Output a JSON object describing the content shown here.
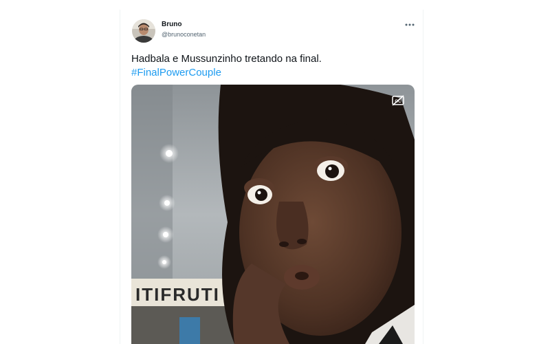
{
  "tweet": {
    "author_name": "Bruno",
    "author_handle": "@brunoconetan",
    "text": "Hadbala e Mussunzinho tretando na final.",
    "hashtag": "#FinalPowerCouple",
    "more_icon": "ellipsis-icon",
    "media": {
      "sign_text": "ITIFRUTI",
      "captions_icon": "closed-captions-off-icon"
    }
  },
  "colors": {
    "text_primary": "#0f1419",
    "text_secondary": "#536471",
    "link": "#1d9bf0",
    "border": "#eff3f4"
  }
}
